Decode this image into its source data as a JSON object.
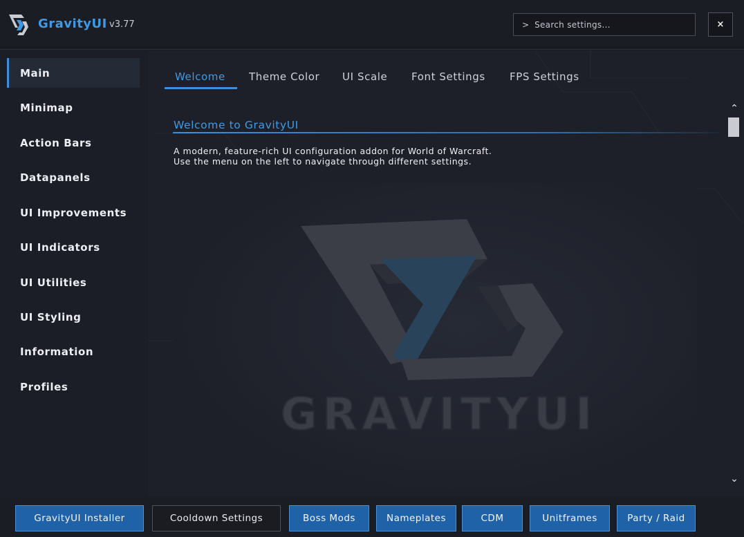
{
  "header": {
    "title": "GravityUI",
    "version": "v3.77",
    "search_prompt": ">",
    "search_placeholder": "Search settings...",
    "close_label": "×"
  },
  "sidebar": {
    "items": [
      {
        "label": "Main",
        "active": true
      },
      {
        "label": "Minimap"
      },
      {
        "label": "Action Bars"
      },
      {
        "label": "Datapanels"
      },
      {
        "label": "UI Improvements"
      },
      {
        "label": "UI Indicators"
      },
      {
        "label": "UI Utilities"
      },
      {
        "label": "UI Styling"
      },
      {
        "label": "Information"
      },
      {
        "label": "Profiles"
      }
    ]
  },
  "tabs": [
    {
      "label": "Welcome",
      "active": true
    },
    {
      "label": "Theme Color"
    },
    {
      "label": "UI Scale"
    },
    {
      "label": "Font Settings"
    },
    {
      "label": "FPS Settings"
    }
  ],
  "content": {
    "section_title": "Welcome to GravityUI",
    "description_line1": "A modern, feature-rich UI configuration addon for World of Warcraft.",
    "description_line2": "Use the menu on the left to navigate through different settings.",
    "banner_wordmark": "GRAVITYUI"
  },
  "scrollbar": {
    "up_icon": "⌃",
    "down_icon": "⌄"
  },
  "footer": {
    "buttons": [
      {
        "label": "GravityUI Installer"
      },
      {
        "label": "Cooldown Settings"
      },
      {
        "label": "Boss Mods"
      },
      {
        "label": "Nameplates"
      },
      {
        "label": "CDM"
      },
      {
        "label": "Unitframes"
      },
      {
        "label": "Party / Raid"
      }
    ]
  },
  "colors": {
    "accent": "#3f9ae6",
    "button_blue": "#1f62a8",
    "background": "#1a1c24",
    "sidebar_active": "#252a37"
  },
  "icons": {
    "logo": "gravityui-logo-icon",
    "close": "close-icon",
    "search": "search-prompt-icon"
  }
}
